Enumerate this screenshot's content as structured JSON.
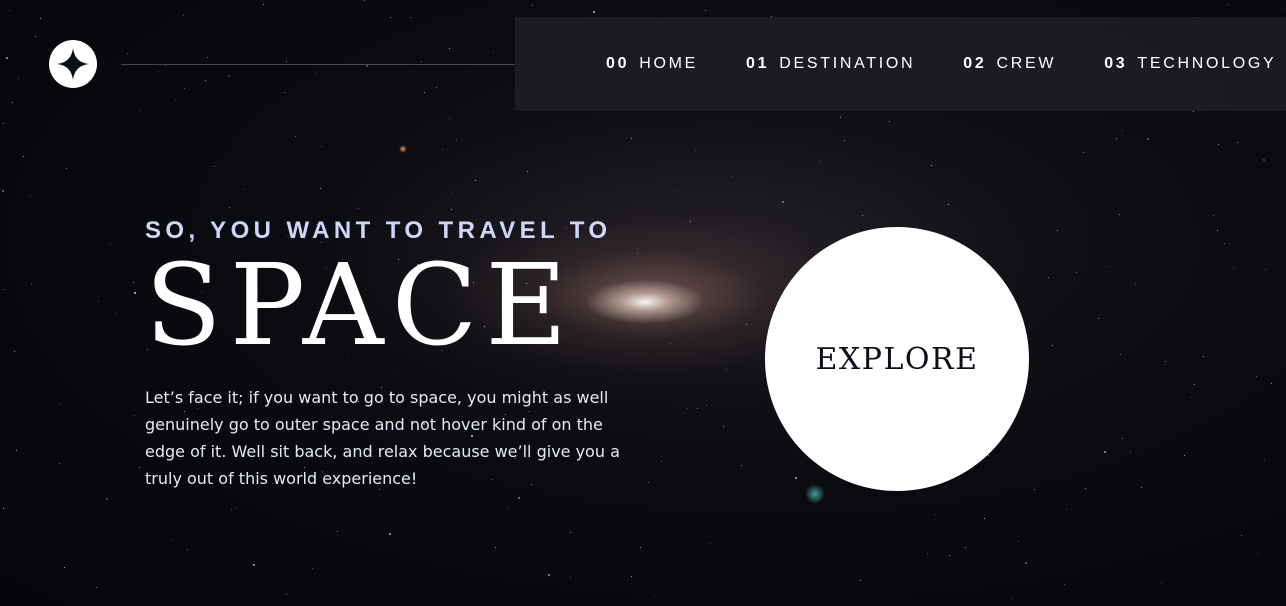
{
  "header": {
    "logo_icon": "star-icon"
  },
  "nav": {
    "items": [
      {
        "num": "00",
        "label": "HOME"
      },
      {
        "num": "01",
        "label": "DESTINATION"
      },
      {
        "num": "02",
        "label": "CREW"
      },
      {
        "num": "03",
        "label": "TECHNOLOGY"
      }
    ]
  },
  "hero": {
    "subtitle": "SO, YOU WANT TO TRAVEL TO",
    "title": "SPACE",
    "description": "Let’s face it; if you want to go to space, you might as well genuinely go to outer space and not hover kind of on the edge of it. Well sit back, and relax because we’ll give you a truly out of this world experience!",
    "explore_label": "EXPLORE"
  },
  "colors": {
    "background": "#0b0d17",
    "accent": "#d0d6f9",
    "white": "#ffffff"
  }
}
